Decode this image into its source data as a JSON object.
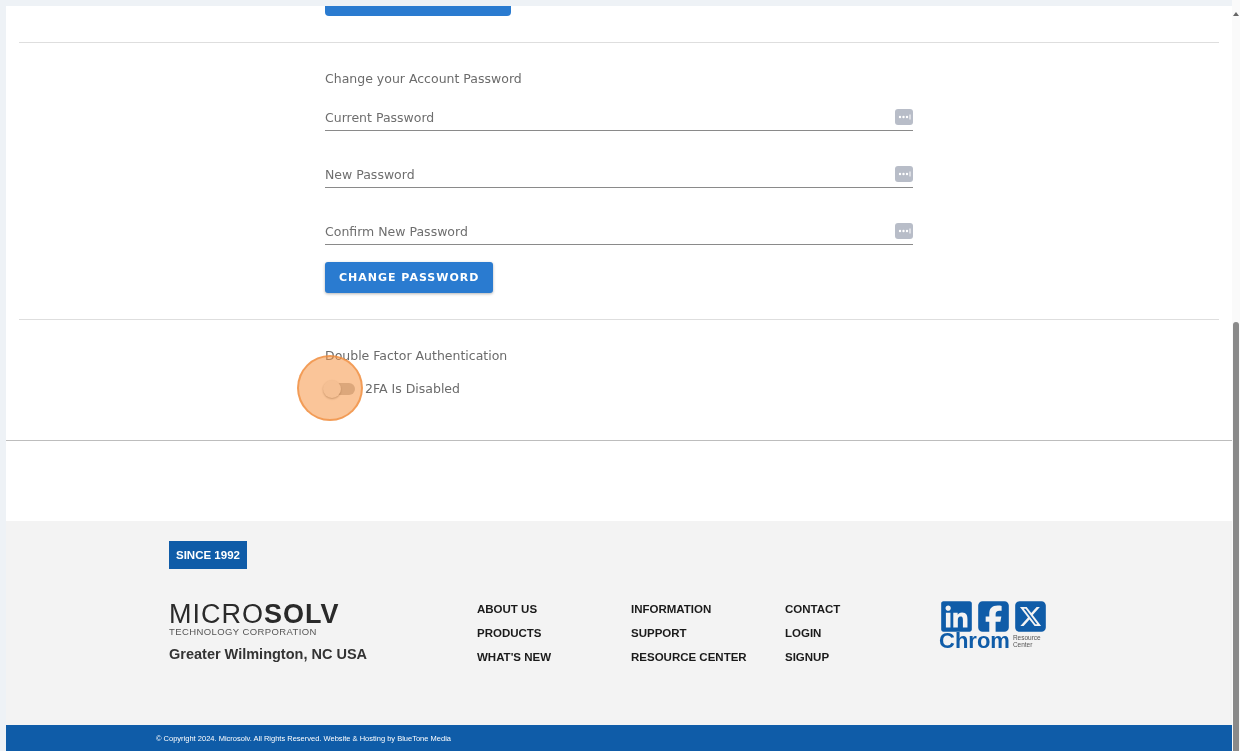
{
  "password_section": {
    "title": "Change your Account Password",
    "fields": [
      {
        "placeholder": "Current Password"
      },
      {
        "placeholder": "New Password"
      },
      {
        "placeholder": "Confirm New Password"
      }
    ],
    "button": "CHANGE PASSWORD"
  },
  "twofa_section": {
    "title": "Double Factor Authentication",
    "toggle": {
      "label": "2FA Is Disabled",
      "on": false
    }
  },
  "footer": {
    "badge": "SINCE 1992",
    "logo": {
      "light": "MICRO",
      "bold": "SOLV",
      "subtitle": "TECHNOLOGY CORPORATION"
    },
    "location": "Greater Wilmington, NC USA",
    "link_columns": [
      [
        "ABOUT US",
        "PRODUCTS",
        "WHAT'S NEW"
      ],
      [
        "INFORMATION",
        "SUPPORT",
        "RESOURCE CENTER"
      ],
      [
        "CONTACT",
        "LOGIN",
        "SIGNUP"
      ]
    ],
    "chrom_logo": {
      "name": "Chrom",
      "tagline_1": "Resource",
      "tagline_2": "Center"
    },
    "copyright": "© Copyright 2024. Microsolv. All Rights Reserved. Website & Hosting by BlueTone Media"
  }
}
